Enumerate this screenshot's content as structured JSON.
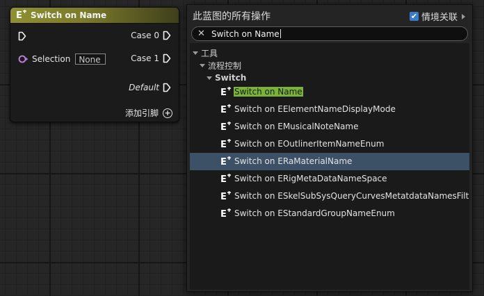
{
  "node": {
    "title": "Switch on Name",
    "selection_label": "Selection",
    "selection_value": "None",
    "case0_label": "Case 0",
    "case1_label": "Case 1",
    "default_label": "Default",
    "add_pin_label": "添加引脚"
  },
  "panel": {
    "title": "此蓝图的所有操作",
    "context_label": "情境关联",
    "context_checked": true,
    "search_value": "Switch on Name",
    "categories": [
      "工具",
      "流程控制",
      "Switch"
    ],
    "items": [
      {
        "label": "Switch on Name"
      },
      {
        "label": "Switch on EElementNameDisplayMode"
      },
      {
        "label": "Switch on EMusicalNoteName"
      },
      {
        "label": "Switch on EOutlinerItemNameEnum"
      },
      {
        "label": "Switch on ERaMaterialName"
      },
      {
        "label": "Switch on ERigMetaDataNameSpace"
      },
      {
        "label": "Switch on ESkelSubSysQueryCurvesMetatdataNamesFilte"
      },
      {
        "label": "Switch on EStandardGroupNameEnum"
      }
    ]
  },
  "colors": {
    "node_header": "#8f8f32",
    "selection_pin": "#c383e0",
    "selected_row": "#3d5166",
    "search_highlight": "#7cb23a",
    "checkbox": "#3b7ac9"
  }
}
